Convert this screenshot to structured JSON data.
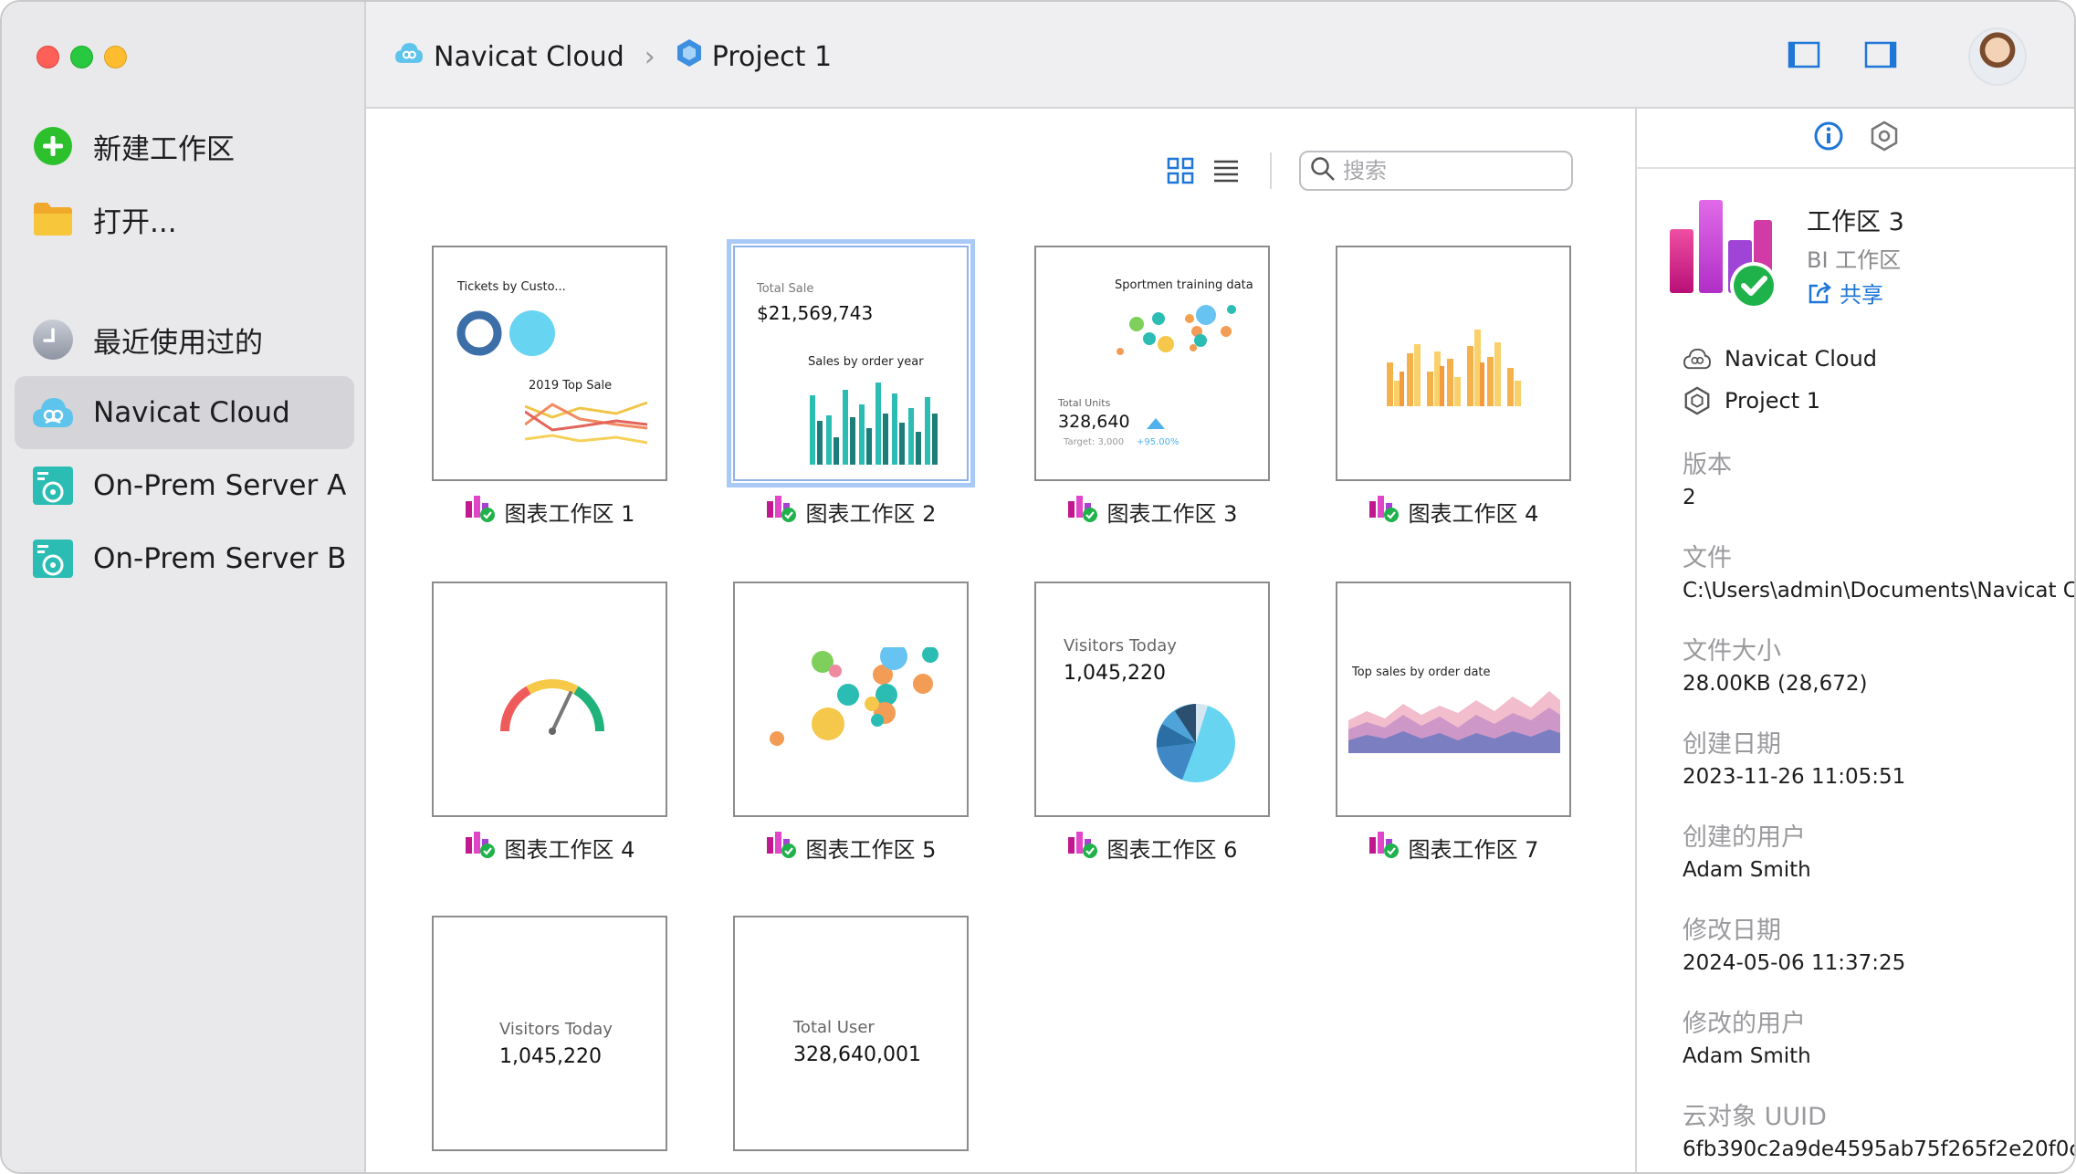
{
  "sidebar": {
    "new_workspace": "新建工作区",
    "open": "打开...",
    "recent": "最近使用过的",
    "navicat_cloud": "Navicat Cloud",
    "server_a": "On-Prem Server A",
    "server_b": "On-Prem Server B"
  },
  "breadcrumb": {
    "root": "Navicat Cloud",
    "project": "Project 1"
  },
  "search": {
    "placeholder": "搜索"
  },
  "workspaces": [
    {
      "name": "图表工作区 1",
      "title1": "Tickets by Custo...",
      "title2": "2019 Top Sale"
    },
    {
      "name": "图表工作区 2",
      "label": "Total Sale",
      "value": "$21,569,743",
      "title": "Sales by order year"
    },
    {
      "name": "图表工作区 3",
      "title": "Sportmen training data",
      "label": "Total Units",
      "value": "328,640",
      "target": "Target: 3,000",
      "delta": "+95.00%"
    },
    {
      "name": "图表工作区 4"
    },
    {
      "name": "图表工作区 4"
    },
    {
      "name": "图表工作区 5"
    },
    {
      "name": "图表工作区 6",
      "label": "Visitors Today",
      "value": "1,045,220"
    },
    {
      "name": "图表工作区 7",
      "title": "Top sales by order date"
    },
    {
      "label": "Visitors Today",
      "value": "1,045,220"
    },
    {
      "label": "Total User",
      "value": "328,640,001"
    }
  ],
  "info": {
    "name": "工作区 3",
    "type": "BI 工作区",
    "share": "共享",
    "location_cloud": "Navicat Cloud",
    "location_project": "Project 1",
    "props": [
      {
        "label": "版本",
        "value": "2"
      },
      {
        "label": "文件",
        "value": "C:\\Users\\admin\\Documents\\Navicat Ch"
      },
      {
        "label": "文件大小",
        "value": "28.00KB (28,672)"
      },
      {
        "label": "创建日期",
        "value": "2023-11-26 11:05:51"
      },
      {
        "label": "创建的用户",
        "value": "Adam Smith"
      },
      {
        "label": "修改日期",
        "value": "2024-05-06 11:37:25"
      },
      {
        "label": "修改的用户",
        "value": "Adam Smith"
      },
      {
        "label": "云对象 UUID",
        "value": "6fb390c2a9de4595ab75f265f2e20f0c"
      }
    ]
  },
  "colors": {
    "accent": "#1e76d7",
    "teal": "#2bbdb4",
    "add_green": "#2cc12c",
    "folder": "#f5b624"
  }
}
